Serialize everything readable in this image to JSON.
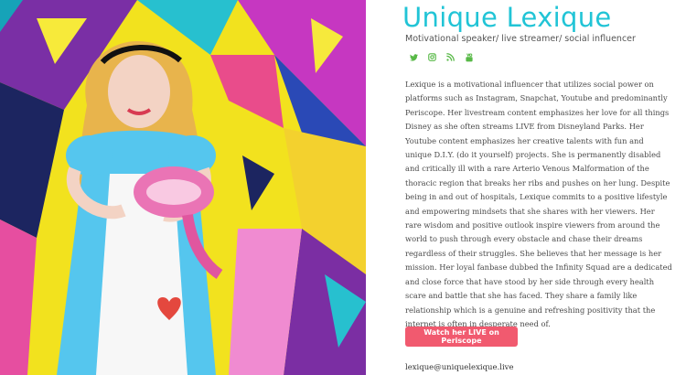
{
  "profile": {
    "name": "Unique Lexique",
    "tagline": "Motivational speaker/ live streamer/ social influencer",
    "bio": "Lexique is a motivational influencer that utilizes social power on platforms such as Instagram, Snapchat, Youtube and predominantly Periscope. Her livestream content emphasizes her love for all things Disney as she often streams LIVE from Disneyland Parks. Her Youtube content emphasizes her creative talents with fun and unique D.I.Y. (do it yourself) projects. She is permanently disabled and critically ill with a rare Arterio Venous Malformation of the thoracic region that breaks her ribs and pushes on her lung. Despite being in and out of hospitals, Lexique commits to a positive lifestyle and empowering mindsets that she shares with her viewers. Her rare wisdom and positive outlook inspire viewers from around the world to push through every obstacle and chase their dreams regardless of their struggles. She believes that her message is her mission. Her loyal fanbase dubbed the Infinity Squad are a dedicated and close force that have stood by her side through every health scare and battle that she has faced. They share a family like relationship which is a genuine and refreshing positivity that the internet is often in desperate need of.",
    "cta_label": "Watch her LIVE on Periscope",
    "email": "lexique@uniquelexique.live"
  },
  "socials": [
    {
      "icon": "twitter-icon"
    },
    {
      "icon": "instagram-icon"
    },
    {
      "icon": "rss-icon"
    },
    {
      "icon": "youtube-icon"
    }
  ],
  "colors": {
    "title": "#21c4d6",
    "social_icons": "#58b947",
    "cta_background": "#f15a6f",
    "body_text": "#4a4a4a"
  }
}
